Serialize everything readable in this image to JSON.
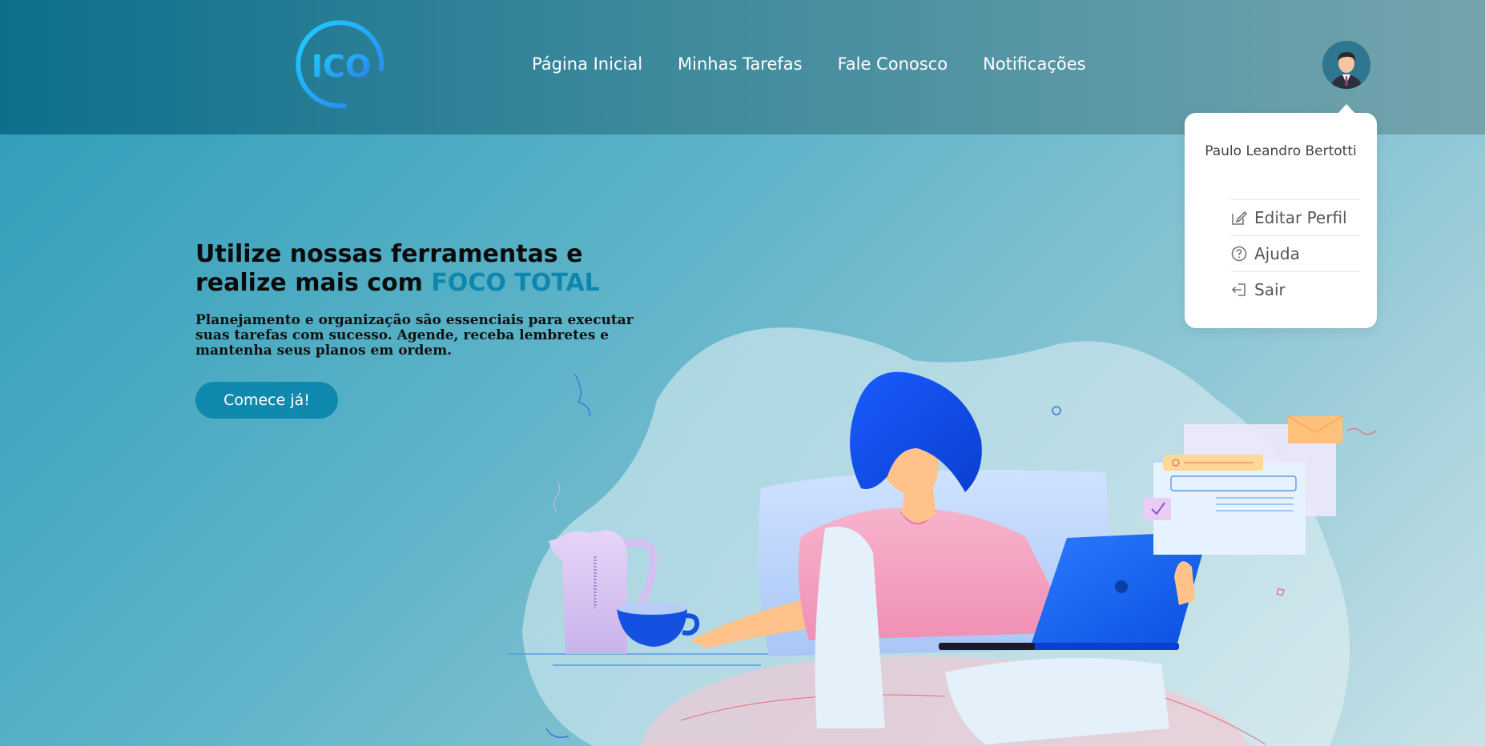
{
  "header": {
    "logo_text": "ICO",
    "nav": [
      {
        "label": "Página Inicial"
      },
      {
        "label": "Minhas Tarefas"
      },
      {
        "label": "Fale Conosco"
      },
      {
        "label": "Notificações"
      }
    ]
  },
  "user_menu": {
    "name": "Paulo Leandro Bertotti",
    "items": [
      {
        "label": "Editar Perfil",
        "icon": "edit-icon"
      },
      {
        "label": "Ajuda",
        "icon": "help-icon"
      },
      {
        "label": "Sair",
        "icon": "logout-icon"
      }
    ]
  },
  "hero": {
    "title_line1": "Utilize nossas ferramentas e",
    "title_line2_prefix": "realize mais com ",
    "title_accent": "FOCO TOTAL",
    "description": "Planejamento e organização são essenciais para executar suas tarefas com sucesso. Agende, receba lembretes e mantenha seus planos em ordem.",
    "cta_label": "Comece já!"
  },
  "colors": {
    "accent": "#0e86ad",
    "cta_background": "#0f89ad",
    "header_start": "#0e6f8b",
    "header_end": "#74a4ad"
  }
}
